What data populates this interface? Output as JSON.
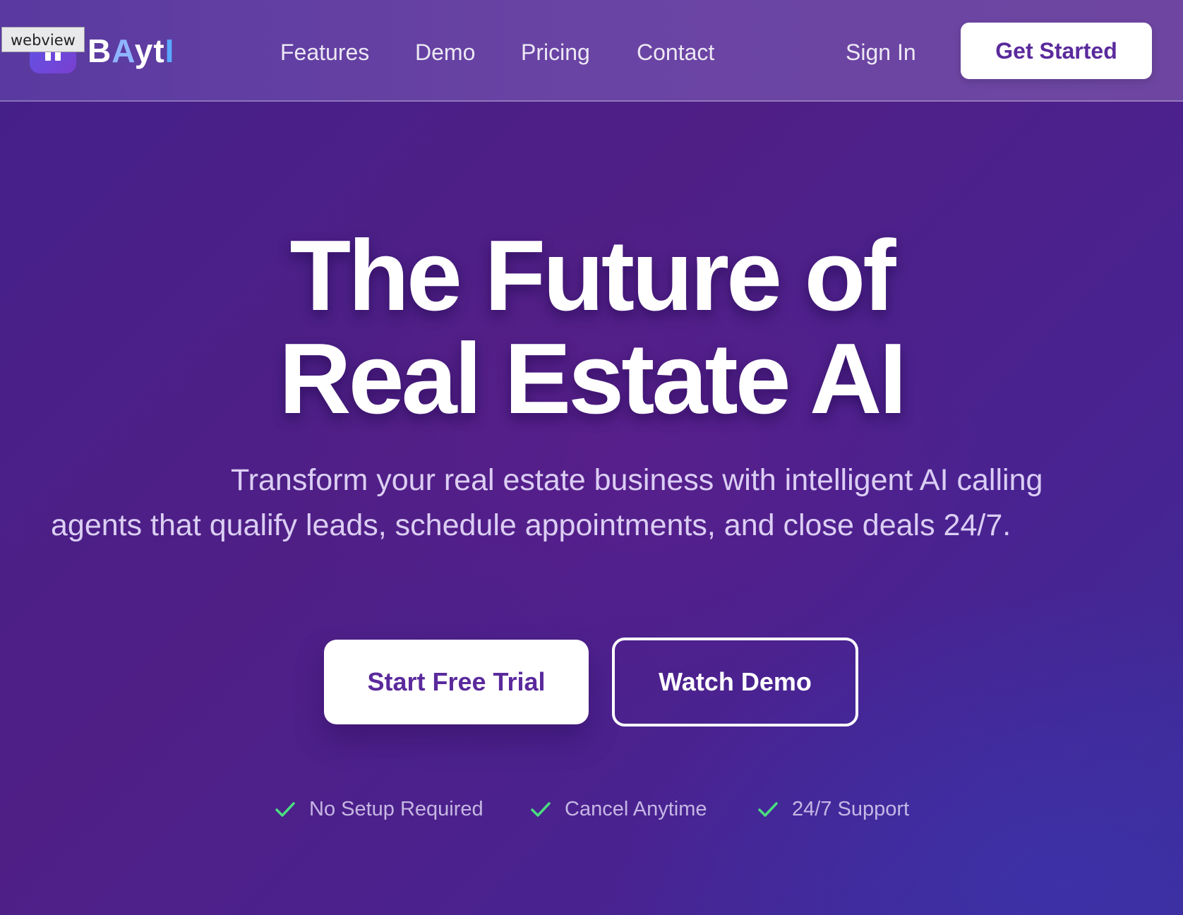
{
  "webview_label": "webview",
  "brand": {
    "name_parts": [
      "B",
      "A",
      "yt",
      "I"
    ],
    "colors": {
      "primary": "#5a2a9c",
      "accent_light_blue": "#8fb4ff",
      "accent_blue": "#5aa8ff",
      "check_green": "#4ade80"
    }
  },
  "nav": {
    "links": [
      "Features",
      "Demo",
      "Pricing",
      "Contact"
    ],
    "sign_in": "Sign In",
    "cta": "Get Started"
  },
  "hero": {
    "title_line1": "The Future of",
    "title_line2": "Real Estate AI",
    "subtitle_line1": "Transform your real estate business with intelligent AI calling",
    "subtitle_line2": "agents that qualify leads, schedule appointments, and close deals 24/7.",
    "primary_button": "Start Free Trial",
    "secondary_button": "Watch Demo"
  },
  "features": [
    {
      "icon": "check-icon",
      "label": "No Setup Required"
    },
    {
      "icon": "check-icon",
      "label": "Cancel Anytime"
    },
    {
      "icon": "check-icon",
      "label": "24/7 Support"
    }
  ]
}
